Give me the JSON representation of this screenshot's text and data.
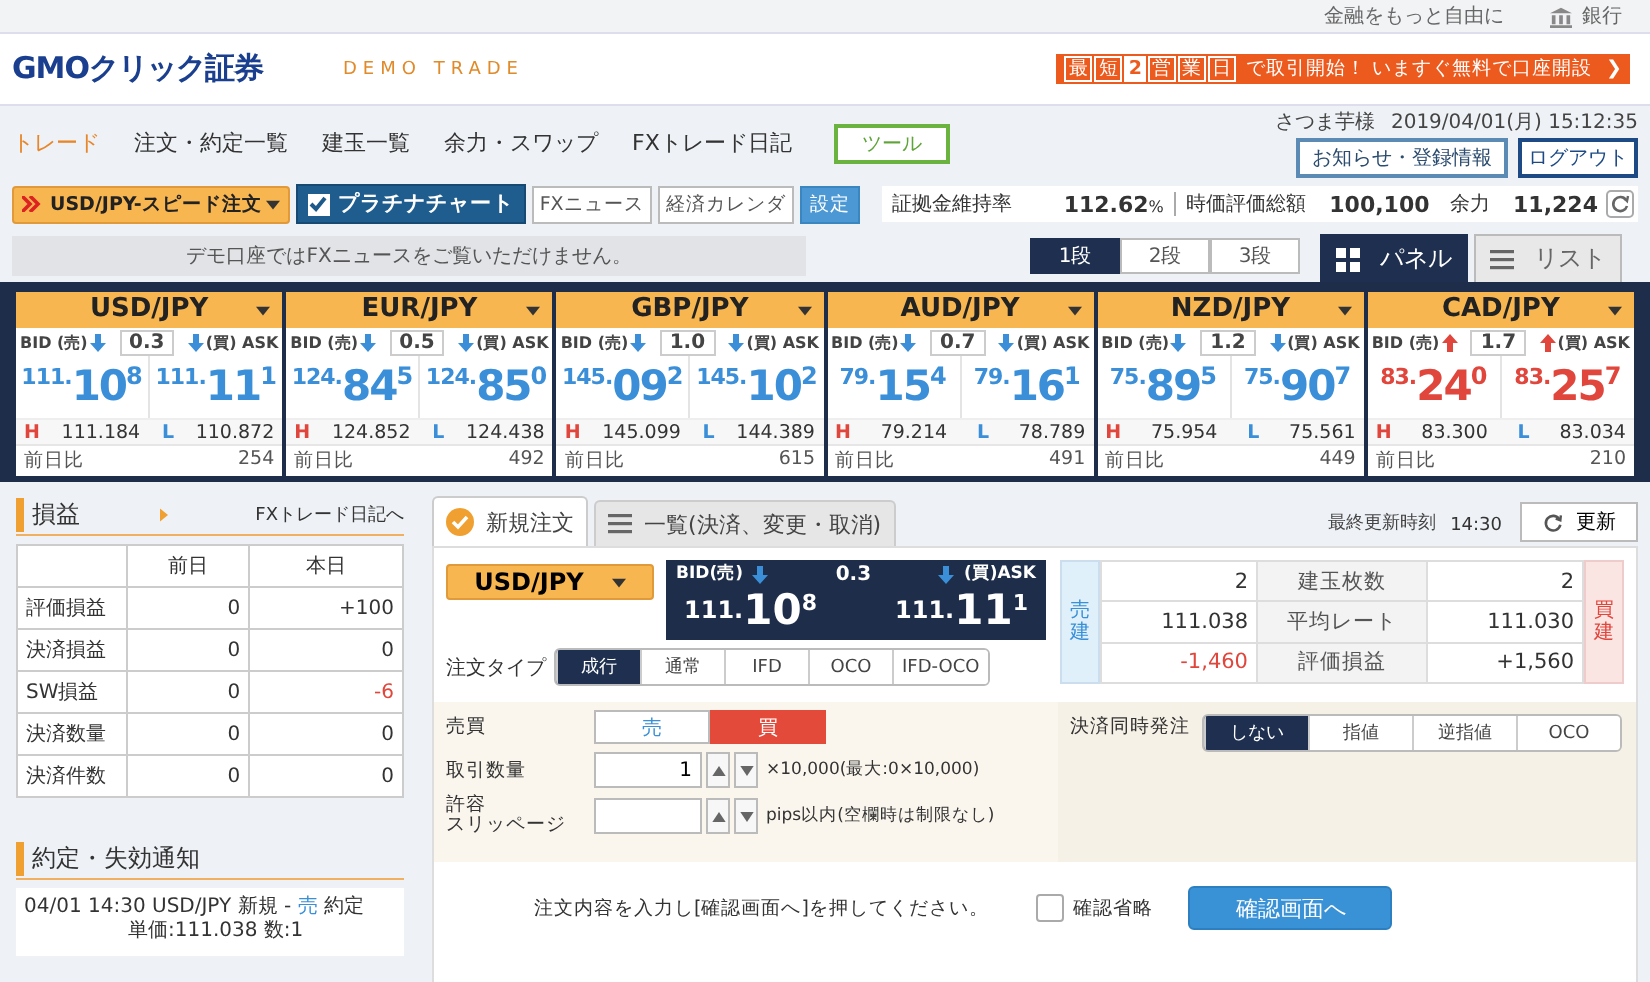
{
  "top_bar": {
    "tagline": "金融をもっと自由に",
    "bank_link": "銀行"
  },
  "header": {
    "logo": "GMOクリック証券",
    "mode": "DEMO TRADE",
    "promo": {
      "badges": [
        "最",
        "短",
        "2",
        "営",
        "業",
        "日"
      ],
      "text": "で取引開始！ いますぐ無料で口座開設",
      "arrow": "❯"
    }
  },
  "nav": {
    "tabs": [
      {
        "label": "トレード",
        "selected": true
      },
      {
        "label": "注文・約定一覧",
        "selected": false
      },
      {
        "label": "建玉一覧",
        "selected": false
      },
      {
        "label": "余力・スワップ",
        "selected": false
      },
      {
        "label": "FXトレード日記",
        "selected": false
      }
    ],
    "tool_button": "ツール",
    "user": "さつま芋様",
    "datetime": "2019/04/01(月) 15:12:35",
    "notice_button": "お知らせ・登録情報",
    "logout_button": "ログアウト"
  },
  "toolbar": {
    "speed_order": "USD/JPY-スピード注文",
    "chart_button": {
      "label": "プラチナチャート",
      "checked": true
    },
    "news_button": "FXニュース",
    "calendar_button": "経済カレンダ",
    "settings_button": "設定"
  },
  "account": [
    {
      "label": "証拠金維持率",
      "value": "112.62",
      "unit": "%"
    },
    {
      "label": "時価評価総額",
      "value": "100,100"
    },
    {
      "label": "余力",
      "value": "11,224"
    }
  ],
  "demo_notice": "デモ口座ではFXニュースをご覧いただけません。",
  "rows_selector": [
    {
      "label": "1段",
      "selected": true
    },
    {
      "label": "2段",
      "selected": false
    },
    {
      "label": "3段",
      "selected": false
    }
  ],
  "view_tabs": [
    {
      "label": "パネル",
      "kind": "grid",
      "selected": true
    },
    {
      "label": "リスト",
      "kind": "list",
      "selected": false
    }
  ],
  "rates": [
    {
      "pair": "USD/JPY",
      "bid_label": "BID (売)",
      "ask_label": "(買) ASK",
      "spread": "0.3",
      "rising": false,
      "bid": {
        "big": "111.",
        "main": "10",
        "pip": "8"
      },
      "ask": {
        "big": "111.",
        "main": "11",
        "pip": "1"
      },
      "high_label": "H",
      "high": "111.184",
      "low_label": "L",
      "low": "110.872",
      "change_label": "前日比",
      "change": "254"
    },
    {
      "pair": "EUR/JPY",
      "bid_label": "BID (売)",
      "ask_label": "(買) ASK",
      "spread": "0.5",
      "rising": false,
      "bid": {
        "big": "124.",
        "main": "84",
        "pip": "5"
      },
      "ask": {
        "big": "124.",
        "main": "85",
        "pip": "0"
      },
      "high_label": "H",
      "high": "124.852",
      "low_label": "L",
      "low": "124.438",
      "change_label": "前日比",
      "change": "492"
    },
    {
      "pair": "GBP/JPY",
      "bid_label": "BID (売)",
      "ask_label": "(買) ASK",
      "spread": "1.0",
      "rising": false,
      "bid": {
        "big": "145.",
        "main": "09",
        "pip": "2"
      },
      "ask": {
        "big": "145.",
        "main": "10",
        "pip": "2"
      },
      "high_label": "H",
      "high": "145.099",
      "low_label": "L",
      "low": "144.389",
      "change_label": "前日比",
      "change": "615"
    },
    {
      "pair": "AUD/JPY",
      "bid_label": "BID (売)",
      "ask_label": "(買) ASK",
      "spread": "0.7",
      "rising": false,
      "bid": {
        "big": "79.",
        "main": "15",
        "pip": "4"
      },
      "ask": {
        "big": "79.",
        "main": "16",
        "pip": "1"
      },
      "high_label": "H",
      "high": "79.214",
      "low_label": "L",
      "low": "78.789",
      "change_label": "前日比",
      "change": "491"
    },
    {
      "pair": "NZD/JPY",
      "bid_label": "BID (売)",
      "ask_label": "(買) ASK",
      "spread": "1.2",
      "rising": false,
      "bid": {
        "big": "75.",
        "main": "89",
        "pip": "5"
      },
      "ask": {
        "big": "75.",
        "main": "90",
        "pip": "7"
      },
      "high_label": "H",
      "high": "75.954",
      "low_label": "L",
      "low": "75.561",
      "change_label": "前日比",
      "change": "449"
    },
    {
      "pair": "CAD/JPY",
      "bid_label": "BID (売)",
      "ask_label": "(買) ASK",
      "spread": "1.7",
      "rising": true,
      "bid": {
        "big": "83.",
        "main": "24",
        "pip": "0"
      },
      "ask": {
        "big": "83.",
        "main": "25",
        "pip": "7"
      },
      "high_label": "H",
      "high": "83.300",
      "low_label": "L",
      "low": "83.034",
      "change_label": "前日比",
      "change": "210"
    }
  ],
  "pnl": {
    "title": "損益",
    "link": "FXトレード日記へ",
    "columns": [
      "前日",
      "本日"
    ],
    "rows": [
      {
        "label": "評価損益",
        "prev": "0",
        "today": "+100",
        "today_negative": false
      },
      {
        "label": "決済損益",
        "prev": "0",
        "today": "0",
        "today_negative": false
      },
      {
        "label": "SW損益",
        "prev": "0",
        "today": "-6",
        "today_negative": true
      },
      {
        "label": "決済数量",
        "prev": "0",
        "today": "0",
        "today_negative": false
      },
      {
        "label": "決済件数",
        "prev": "0",
        "today": "0",
        "today_negative": false
      }
    ]
  },
  "notices": {
    "title": "約定・失効通知",
    "items": [
      {
        "time": "04/01 14:30",
        "pair": "USD/JPY",
        "type": "新規 -",
        "side": "売",
        "sell_side": true,
        "status": "約定",
        "detail": "単価:111.038  数:1"
      }
    ]
  },
  "order": {
    "tabs": [
      {
        "label": "新規注文",
        "kind": "check",
        "selected": true
      },
      {
        "label": "一覧(決済、変更・取消)",
        "kind": "list",
        "selected": false
      }
    ],
    "updated_label": "最終更新時刻",
    "updated_time": "14:30",
    "refresh_button": "更新",
    "pair": "USD/JPY",
    "quote": {
      "bid_label": "BID(売)",
      "ask_label": "(買)ASK",
      "spread": "0.3",
      "rising": false,
      "bid": {
        "big": "111.",
        "main": "10",
        "pip": "8"
      },
      "ask": {
        "big": "111.",
        "main": "11",
        "pip": "1"
      }
    },
    "positions": {
      "sell_label": "売建",
      "buy_label": "買建",
      "rows": [
        {
          "sell": "2",
          "label": "建玉枚数",
          "buy": "2",
          "sell_negative": false
        },
        {
          "sell": "111.038",
          "label": "平均レート",
          "buy": "111.030",
          "sell_negative": false
        },
        {
          "sell": "-1,460",
          "label": "評価損益",
          "buy": "+1,560",
          "sell_negative": true
        }
      ]
    },
    "order_type": {
      "label": "注文タイプ",
      "options": [
        {
          "label": "成行",
          "selected": true
        },
        {
          "label": "通常",
          "selected": false
        },
        {
          "label": "IFD",
          "selected": false
        },
        {
          "label": "OCO",
          "selected": false
        },
        {
          "label": "IFD-OCO",
          "selected": false
        }
      ]
    },
    "side": {
      "label": "売買",
      "options": [
        {
          "label": "売",
          "kind": "sell",
          "selected": false
        },
        {
          "label": "買",
          "kind": "buy",
          "selected": true
        }
      ]
    },
    "quantity": {
      "label": "取引数量",
      "value": "1",
      "note": "×10,000(最大:0×10,000)"
    },
    "slippage": {
      "label_lines": [
        "許容",
        "スリッページ"
      ],
      "note": "pips以内(空欄時は制限なし)"
    },
    "settlement": {
      "label": "決済同時発注",
      "options": [
        {
          "label": "しない",
          "selected": true
        },
        {
          "label": "指値",
          "selected": false
        },
        {
          "label": "逆指値",
          "selected": false
        },
        {
          "label": "OCO",
          "selected": false
        }
      ]
    },
    "instruction": "注文内容を入力し[確認画面へ]を押してください。",
    "skip_confirm": {
      "label": "確認省略",
      "checked": false
    },
    "confirm_button": "確認画面へ"
  }
}
